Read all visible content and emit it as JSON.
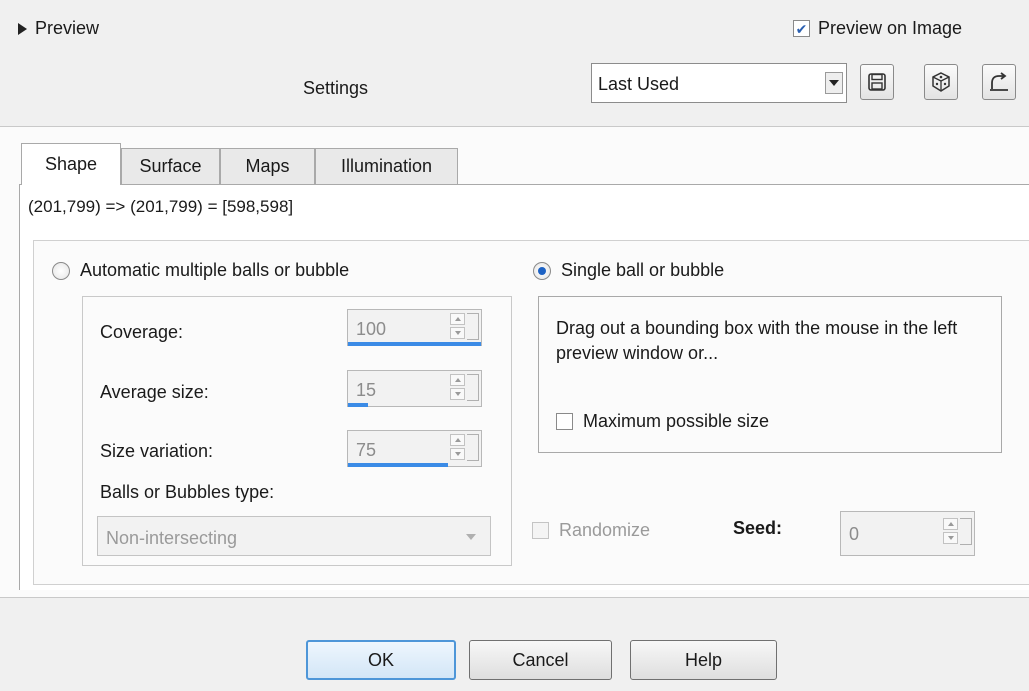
{
  "header": {
    "preview_label": "Preview",
    "preview_on_image_label": "Preview on Image",
    "preview_on_image_checked": true,
    "settings_label": "Settings",
    "preset_value": "Last Used"
  },
  "tabs": [
    {
      "label": "Shape",
      "active": true
    },
    {
      "label": "Surface",
      "active": false
    },
    {
      "label": "Maps",
      "active": false
    },
    {
      "label": "Illumination",
      "active": false
    }
  ],
  "shape": {
    "coords_text": "(201,799) => (201,799) = [598,598]",
    "auto_option_label": "Automatic multiple balls or bubble",
    "auto_selected": false,
    "coverage": {
      "label": "Coverage:",
      "value": "100",
      "max": 100
    },
    "average_size": {
      "label": "Average size:",
      "value": "15",
      "max": 100
    },
    "size_variation": {
      "label": "Size variation:",
      "value": "75",
      "max": 100
    },
    "type_label": "Balls or Bubbles type:",
    "type_value": "Non-intersecting",
    "single_option_label": "Single ball or bubble",
    "single_selected": true,
    "instructions": "Drag out a bounding box with the mouse in the left preview window or...",
    "max_size_label": "Maximum possible size",
    "max_size_checked": false,
    "randomize_label": "Randomize",
    "randomize_checked": false,
    "seed_label": "Seed:",
    "seed_value": "0"
  },
  "footer": {
    "ok_label": "OK",
    "cancel_label": "Cancel",
    "help_label": "Help"
  },
  "colors": {
    "accent": "#3b8be6",
    "radio_selected": "#1d62c4",
    "ok_border": "#4e96d8"
  }
}
